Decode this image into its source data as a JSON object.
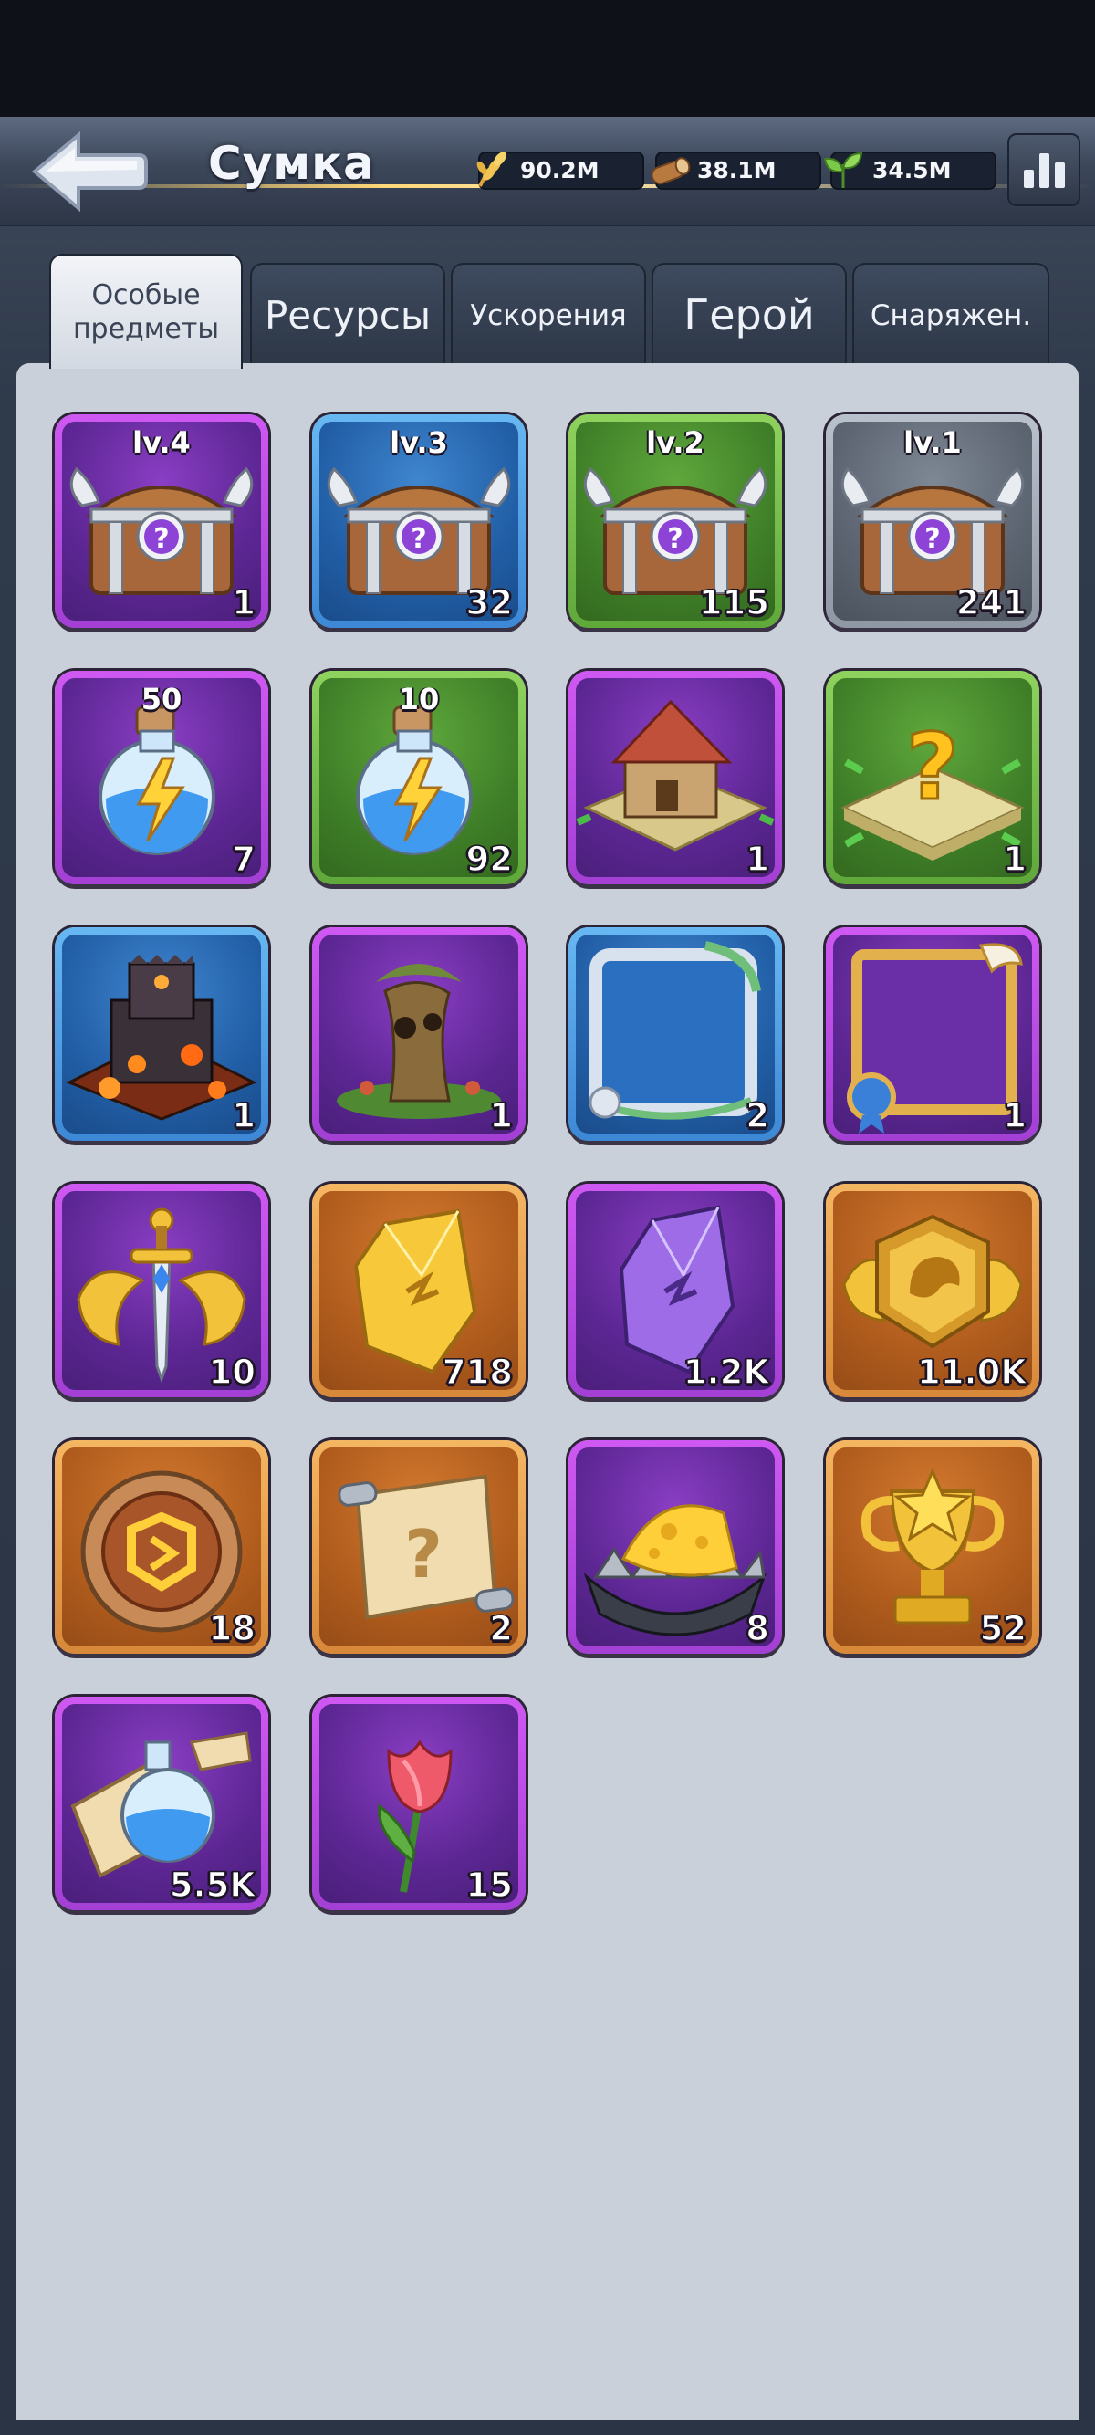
{
  "header": {
    "title": "Сумка",
    "resources": [
      {
        "icon": "grain-icon",
        "value": "90.2M"
      },
      {
        "icon": "wood-icon",
        "value": "38.1M"
      },
      {
        "icon": "leaf-icon",
        "value": "34.5M"
      }
    ]
  },
  "tabs": [
    {
      "label": "Особые предметы",
      "active": true
    },
    {
      "label": "Ресурсы",
      "active": false
    },
    {
      "label": "Ускорения",
      "active": false
    },
    {
      "label": "Герой",
      "active": false
    },
    {
      "label": "Снаряжен.",
      "active": false
    }
  ],
  "items": [
    {
      "name": "chest-lv4",
      "quality": "purple",
      "top": "lv.4",
      "count": "1",
      "icon": "winged-chest-icon"
    },
    {
      "name": "chest-lv3",
      "quality": "blue",
      "top": "lv.3",
      "count": "32",
      "icon": "winged-chest-icon"
    },
    {
      "name": "chest-lv2",
      "quality": "green",
      "top": "lv.2",
      "count": "115",
      "icon": "winged-chest-icon"
    },
    {
      "name": "chest-lv1",
      "quality": "gray",
      "top": "lv.1",
      "count": "241",
      "icon": "winged-chest-icon"
    },
    {
      "name": "stamina-potion-50",
      "quality": "purple",
      "top": "50",
      "count": "7",
      "icon": "lightning-potion-icon"
    },
    {
      "name": "stamina-potion-10",
      "quality": "green",
      "top": "10",
      "count": "92",
      "icon": "lightning-potion-icon"
    },
    {
      "name": "building-relocation",
      "quality": "purple",
      "top": "",
      "count": "1",
      "icon": "house-tile-icon"
    },
    {
      "name": "random-relocation",
      "quality": "green",
      "top": "",
      "count": "1",
      "icon": "question-tile-icon"
    },
    {
      "name": "lava-castle-skin",
      "quality": "blue",
      "top": "",
      "count": "1",
      "icon": "lava-castle-icon"
    },
    {
      "name": "tree-house-skin",
      "quality": "purple",
      "top": "",
      "count": "1",
      "icon": "tree-house-icon"
    },
    {
      "name": "avatar-frame-blue",
      "quality": "blue",
      "top": "",
      "count": "2",
      "icon": "blue-frame-icon"
    },
    {
      "name": "avatar-frame-purple",
      "quality": "purple",
      "top": "",
      "count": "1",
      "icon": "purple-frame-icon"
    },
    {
      "name": "sword-emblem",
      "quality": "purple",
      "top": "",
      "count": "10",
      "icon": "winged-sword-icon"
    },
    {
      "name": "gold-crystal",
      "quality": "orange",
      "top": "",
      "count": "718",
      "icon": "gold-crystal-icon"
    },
    {
      "name": "purple-crystal",
      "quality": "purple",
      "top": "",
      "count": "1.2K",
      "icon": "purple-crystal-icon"
    },
    {
      "name": "lion-medal",
      "quality": "orange",
      "top": "",
      "count": "11.0K",
      "icon": "lion-medal-icon"
    },
    {
      "name": "rune-token",
      "quality": "orange",
      "top": "",
      "count": "18",
      "icon": "rune-coin-icon"
    },
    {
      "name": "mystery-scroll",
      "quality": "orange",
      "top": "",
      "count": "2",
      "icon": "question-scroll-icon"
    },
    {
      "name": "cheese-trap",
      "quality": "purple",
      "top": "",
      "count": "8",
      "icon": "cheese-trap-icon"
    },
    {
      "name": "golden-trophy",
      "quality": "orange",
      "top": "",
      "count": "52",
      "icon": "star-trophy-icon"
    },
    {
      "name": "scroll-potion",
      "quality": "purple",
      "top": "",
      "count": "5.5K",
      "icon": "scroll-potion-icon"
    },
    {
      "name": "tulip",
      "quality": "purple",
      "top": "",
      "count": "15",
      "icon": "tulip-icon"
    }
  ]
}
